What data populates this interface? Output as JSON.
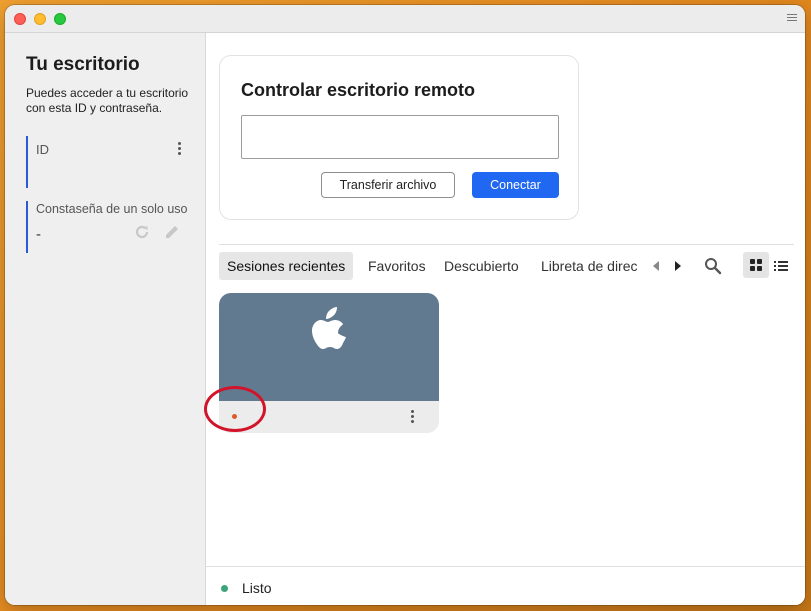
{
  "window": {
    "titlebar": {
      "controls": [
        "close",
        "minimize",
        "maximize"
      ],
      "menu_icon": "hamburger-menu-icon"
    }
  },
  "sidebar": {
    "title": "Tu escritorio",
    "description": "Puedes acceder a tu escritorio con esta ID y contraseña.",
    "id_block": {
      "label": "ID",
      "value": ""
    },
    "password_block": {
      "label": "Constaseña de un solo uso",
      "value": "-"
    }
  },
  "remote_control": {
    "title": "Controlar escritorio remoto",
    "input_value": "",
    "transfer_label": "Transferir archivo",
    "connect_label": "Conectar"
  },
  "tabs": {
    "items": [
      {
        "label": "Sesiones recientes",
        "active": true
      },
      {
        "label": "Favoritos",
        "active": false
      },
      {
        "label": "Descubierto",
        "active": false
      },
      {
        "label": "Libreta de direc",
        "active": false
      }
    ],
    "view_mode": "grid"
  },
  "sessions": [
    {
      "os_icon": "apple-icon",
      "status": "offline",
      "label": ""
    }
  ],
  "status": {
    "text": "Listo",
    "color": "#3aa57a"
  },
  "colors": {
    "accent": "#2067f1",
    "thumb": "#627a90",
    "annotation": "#d2142a"
  }
}
